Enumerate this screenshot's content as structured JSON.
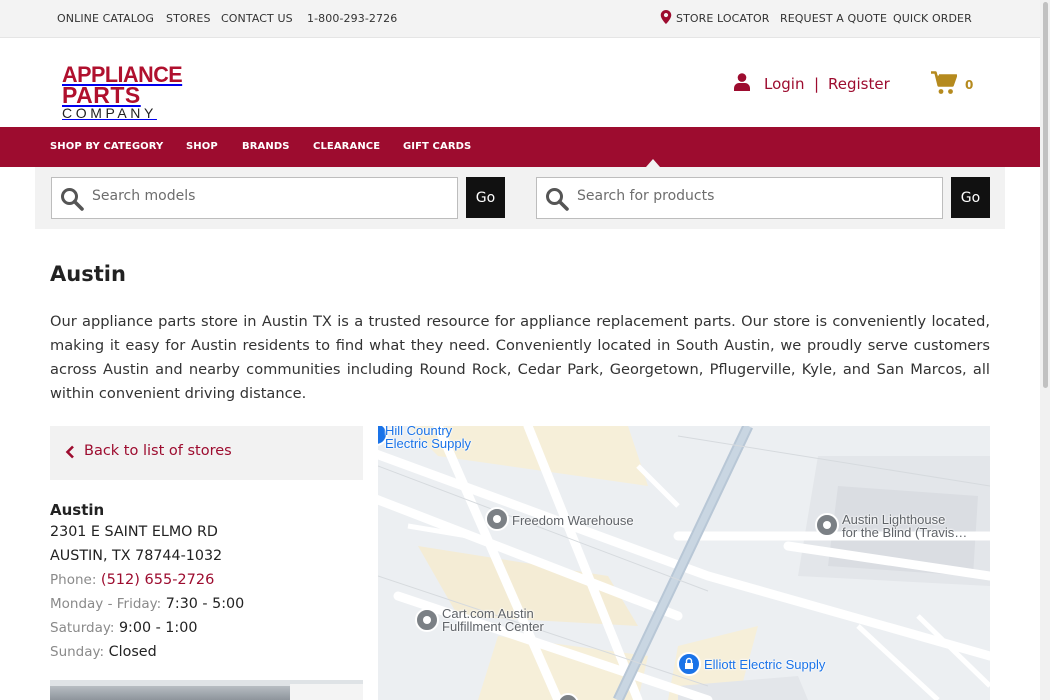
{
  "topbar": {
    "links": [
      "ONLINE CATALOG",
      "STORES",
      "CONTACT US",
      "1-800-293-2726"
    ],
    "right_links": [
      "STORE LOCATOR",
      "REQUEST A QUOTE",
      "QUICK ORDER"
    ]
  },
  "logo": {
    "line1": "APPLIANCE",
    "line2": "PARTS",
    "line3": "COMPANY"
  },
  "account": {
    "login": "Login",
    "separator": "|",
    "register": "Register",
    "cart_count": "0"
  },
  "nav": {
    "items": [
      "SHOP BY CATEGORY",
      "SHOP",
      "BRANDS",
      "CLEARANCE",
      "GIFT CARDS"
    ]
  },
  "search": {
    "models_placeholder": "Search models",
    "products_placeholder": "Search for products",
    "go_label": "Go"
  },
  "page": {
    "title": "Austin",
    "intro": "Our appliance parts store in Austin TX is a trusted resource for appliance replacement parts. Our store is conveniently located, making it easy for Austin residents to find what they need. Conveniently located in South Austin, we proudly serve customers across Austin and nearby communities including Round Rock, Cedar Park, Georgetown, Pflugerville, Kyle, and San Marcos, all within convenient driving distance."
  },
  "store": {
    "back_label": "Back to list of stores",
    "name": "Austin",
    "address1": "2301 E SAINT ELMO RD",
    "address2": "AUSTIN, TX 78744-1032",
    "phone_label": "Phone:",
    "phone": "(512) 655-2726",
    "hours": [
      {
        "label": "Monday - Friday:",
        "value": "7:30 - 5:00"
      },
      {
        "label": "Saturday:",
        "value": "9:00 - 1:00"
      },
      {
        "label": "Sunday:",
        "value": "Closed"
      }
    ]
  },
  "map": {
    "pois": [
      {
        "line1": "Hill Country",
        "line2": "Electric Supply",
        "color": "blue"
      },
      {
        "line1": "Freedom Warehouse",
        "line2": "",
        "color": "gray"
      },
      {
        "line1": "Austin Lighthouse",
        "line2": "for the Blind (Travis…",
        "color": "gray"
      },
      {
        "line1": "Cart.com Austin",
        "line2": "Fulfillment Center",
        "color": "gray"
      },
      {
        "line1": "Elliott Electric Supply",
        "line2": "",
        "color": "blue"
      }
    ]
  },
  "colors": {
    "brand": "#9d0c2f",
    "nav_bg": "#9d0c2f",
    "topbar_bg": "#f3f3f3",
    "map_blue": "#1a73e8"
  }
}
